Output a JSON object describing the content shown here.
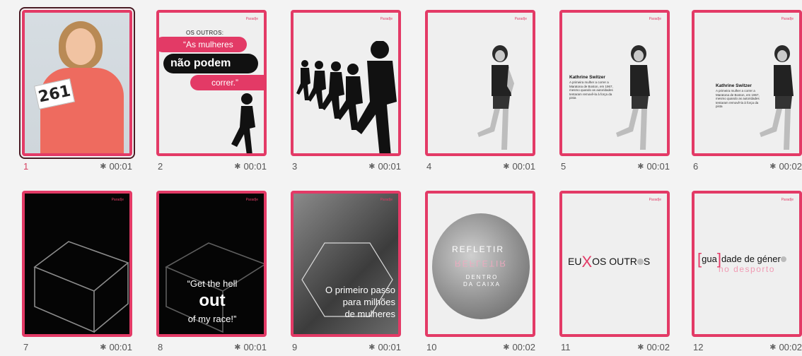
{
  "slides": [
    {
      "number": "1",
      "duration": "00:01",
      "bib": "261"
    },
    {
      "number": "2",
      "duration": "00:01",
      "label": "OS OUTROS:",
      "line1": "“As mulheres",
      "line2": "não podem",
      "line3": "correr.”",
      "brand": "Parad|e"
    },
    {
      "number": "3",
      "duration": "00:01",
      "brand": "Parad|e"
    },
    {
      "number": "4",
      "duration": "00:01",
      "brand": "Parad|e"
    },
    {
      "number": "5",
      "duration": "00:01",
      "brand": "Parad|e",
      "title": "Kathrine Switzer",
      "text": "A primeira mulher a correr a Maratona de Boston, em 1967, mesmo quando as autoridades tentaram removê-la à força da pista"
    },
    {
      "number": "6",
      "duration": "00:02",
      "brand": "Parad|e",
      "title": "Kathrine Switzer",
      "text": "A primeira mulher a correr a Maratona de Boston, em 1967, mesmo quando as autoridades tentaram removê-la à força da pista"
    },
    {
      "number": "7",
      "duration": "00:01",
      "brand": "Parad|e"
    },
    {
      "number": "8",
      "duration": "00:01",
      "brand": "Parad|e",
      "q1": "“Get the hell",
      "q2": "out",
      "q3": "of my race!”"
    },
    {
      "number": "9",
      "duration": "00:01",
      "brand": "Parad|e",
      "l1": "O primeiro passo",
      "l2": "para milhões",
      "l3": "de mulheres"
    },
    {
      "number": "10",
      "duration": "00:02",
      "t1": "REFLETIR",
      "t2": "REFLETIR",
      "t3a": "DENTRO",
      "t3b": "DA CAIXA"
    },
    {
      "number": "11",
      "duration": "00:02",
      "brand": "Parad|e",
      "a": "EU",
      "x": "X",
      "b": "OS OUTR",
      "c": "S"
    },
    {
      "number": "12",
      "duration": "00:02",
      "brand": "Parad|e",
      "p1": "[",
      "g": "gua",
      "p2": "]",
      "rest": "dade de géner",
      "sub": "no desporto"
    }
  ],
  "icons": {
    "duration": "star-icon"
  },
  "colors": {
    "accent": "#e33a66",
    "selected_outline": "#4a1a24"
  }
}
